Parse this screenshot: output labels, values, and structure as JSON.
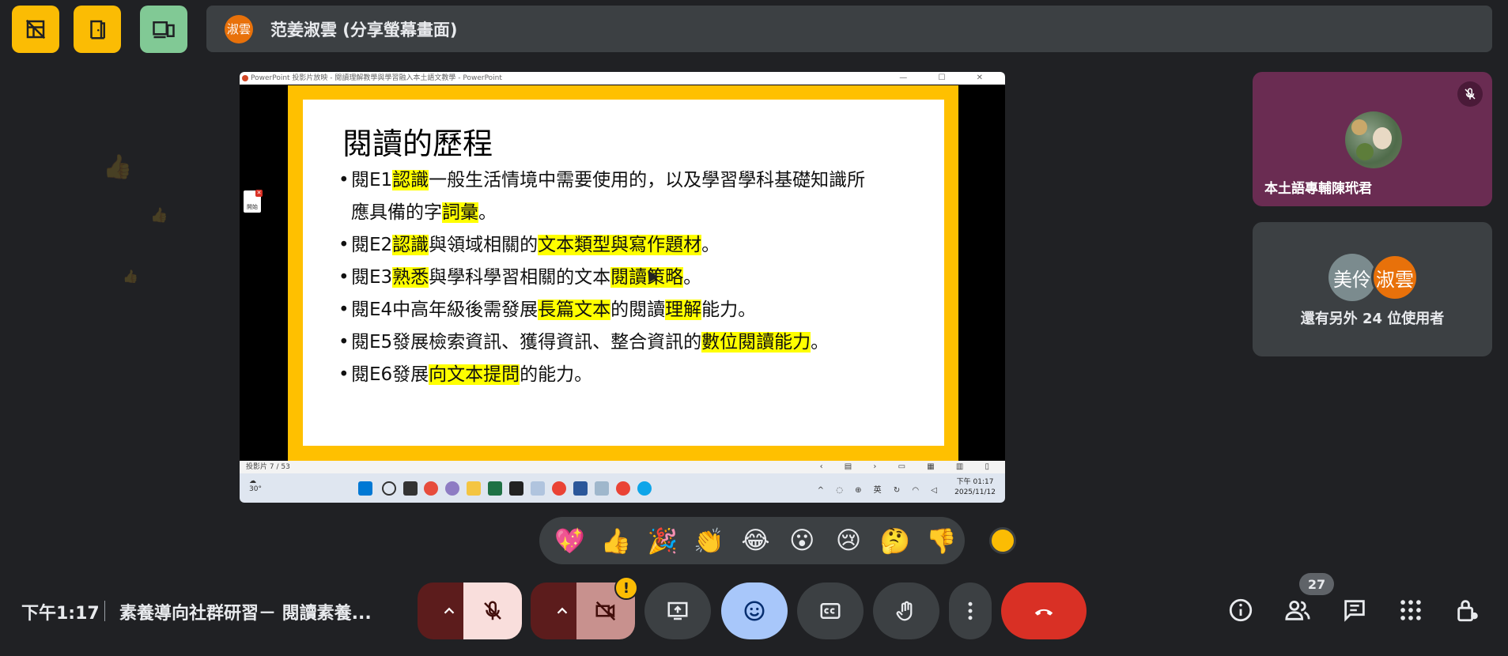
{
  "top_bar": {
    "buttons": [
      {
        "name": "hide-tiles-button",
        "icon": "no-grid-icon",
        "color": "#fbbc04"
      },
      {
        "name": "companion-mode-button",
        "icon": "door-icon",
        "color": "#fbbc04"
      },
      {
        "name": "devices-button",
        "icon": "devices-icon",
        "color": "#81c995"
      }
    ],
    "presenter_initials": "淑雲",
    "presenter_label": "范姜淑雲 (分享螢幕畫面)"
  },
  "shared_screen": {
    "window_title": "PowerPoint 投影片放映 - 閱讀理解教學與學習融入本土語文教學 - PowerPoint",
    "window_controls": "— ☐ ✕",
    "side_app_label": "開始",
    "slide": {
      "title": "閱讀的歷程",
      "bullets": [
        {
          "line1": [
            [
              "閱E1",
              false
            ],
            [
              "認識",
              true
            ],
            [
              "一般生活情境中需要使用的，以及學習學科基礎知識所",
              false
            ]
          ],
          "line2": [
            [
              "應具備的字",
              false
            ],
            [
              "詞彙",
              true
            ],
            [
              "。",
              false
            ]
          ]
        },
        {
          "line1": [
            [
              "閱E2",
              false
            ],
            [
              "認識",
              true
            ],
            [
              "與領域相關的",
              false
            ],
            [
              "文本類型與寫作題材",
              true
            ],
            [
              "。",
              false
            ]
          ]
        },
        {
          "line1": [
            [
              "閱E3",
              false
            ],
            [
              "熟悉",
              true
            ],
            [
              "與學科學習相關的文本",
              false
            ],
            [
              "閱讀策略",
              true
            ],
            [
              "。",
              false
            ]
          ]
        },
        {
          "line1": [
            [
              "閱E4中高年級後需發展",
              false
            ],
            [
              "長篇文本",
              true
            ],
            [
              "的閱讀",
              false
            ],
            [
              "理解",
              true
            ],
            [
              "能力。",
              false
            ]
          ]
        },
        {
          "line1": [
            [
              "閱E5發展檢索資訊、獲得資訊、整合資訊的",
              false
            ],
            [
              "數位閱讀能力",
              true
            ],
            [
              "。",
              false
            ]
          ]
        },
        {
          "line1": [
            [
              "閱E6發展",
              false
            ],
            [
              "向文本提問",
              true
            ],
            [
              "的能力。",
              false
            ]
          ]
        }
      ]
    },
    "status_left": "投影片 7 / 53",
    "status_right": "‹ ▤ › ▭ ▦ ▥ ▯",
    "taskbar": {
      "weather": "30°",
      "tray": "^ ◌ ⊕ 英 ↻ ◠ ◁",
      "time": "下午 01:17",
      "date": "2025/11/12"
    }
  },
  "participants": [
    {
      "name": "本土語專輔陳玳君",
      "muted": true,
      "tile_color": "#6a2c52"
    },
    {
      "others_label": "還有另外 24 位使用者",
      "avatars": [
        {
          "initials": "美伶",
          "color": "#7b8b8e"
        },
        {
          "initials": "淑雲",
          "color": "#e8710a"
        }
      ]
    }
  ],
  "reactions": [
    "💖",
    "👍",
    "🎉",
    "👏",
    "😂",
    "😮",
    "😢",
    "🤔",
    "👎"
  ],
  "bottom_bar": {
    "time": "下午1:17",
    "meeting_title": "素養導向社群研習－ 閱讀素養...",
    "camera_warning": "!",
    "people_count": "27"
  },
  "colors": {
    "background": "#202124",
    "end_call": "#d93025",
    "reaction_active": "#a8c7fa",
    "mic_off": "#f9dedc",
    "cam_off": "#c8918e"
  }
}
